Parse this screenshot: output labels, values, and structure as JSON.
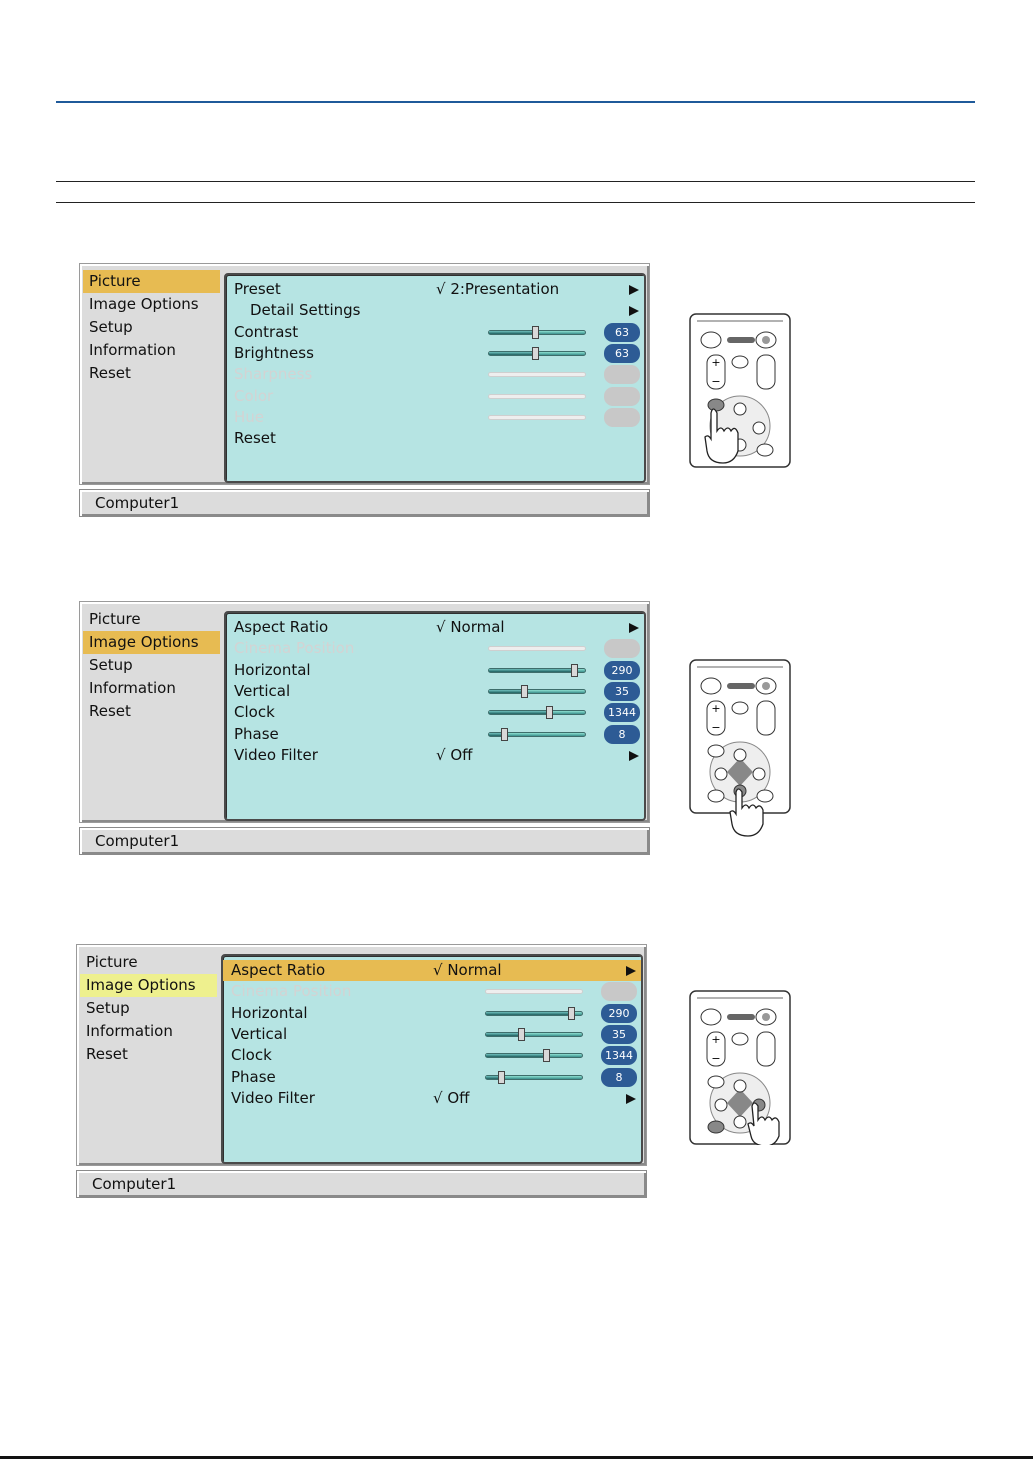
{
  "osd_screens": [
    {
      "menu": [
        {
          "label": "Picture",
          "state": "selected"
        },
        {
          "label": "Image Options",
          "state": ""
        },
        {
          "label": "Setup",
          "state": ""
        },
        {
          "label": "Information",
          "state": ""
        },
        {
          "label": "Reset",
          "state": ""
        }
      ],
      "rows": [
        {
          "label": "Preset",
          "value": "√ 2:Presentation",
          "arrow": true
        },
        {
          "label": "Detail Settings",
          "sub": true,
          "arrow": true
        },
        {
          "label": "Contrast",
          "slider": 0.49,
          "badge": "63"
        },
        {
          "label": "Brightness",
          "slider": 0.49,
          "badge": "63"
        },
        {
          "label": "Sharpness",
          "disabled": true,
          "slider": 0,
          "badge": ""
        },
        {
          "label": "Color",
          "disabled": true,
          "slider": 0,
          "badge": ""
        },
        {
          "label": "Hue",
          "disabled": true,
          "slider": 0,
          "badge": ""
        },
        {
          "label": "Reset"
        }
      ],
      "status": "Computer1"
    },
    {
      "menu": [
        {
          "label": "Picture",
          "state": ""
        },
        {
          "label": "Image Options",
          "state": "selected"
        },
        {
          "label": "Setup",
          "state": ""
        },
        {
          "label": "Information",
          "state": ""
        },
        {
          "label": "Reset",
          "state": ""
        }
      ],
      "rows": [
        {
          "label": "Aspect Ratio",
          "value": "√ Normal",
          "arrow": true
        },
        {
          "label": "Cinema Position",
          "disabled": true,
          "slider": 0,
          "badge": ""
        },
        {
          "label": "Horizontal",
          "slider": 0.9,
          "badge": "290"
        },
        {
          "label": "Vertical",
          "slider": 0.37,
          "badge": "35"
        },
        {
          "label": "Clock",
          "slider": 0.64,
          "badge": "1344"
        },
        {
          "label": "Phase",
          "slider": 0.17,
          "badge": "8"
        },
        {
          "label": "Video Filter",
          "value": "√ Off",
          "arrow": true
        }
      ],
      "status": "Computer1"
    },
    {
      "menu": [
        {
          "label": "Picture",
          "state": ""
        },
        {
          "label": "Image Options",
          "state": "selected-light"
        },
        {
          "label": "Setup",
          "state": ""
        },
        {
          "label": "Information",
          "state": ""
        },
        {
          "label": "Reset",
          "state": ""
        }
      ],
      "rows": [
        {
          "label": "Aspect Ratio",
          "value": "√ Normal",
          "arrow": true,
          "highlight": true
        },
        {
          "label": "Cinema Position",
          "disabled": true,
          "slider": 0,
          "badge": ""
        },
        {
          "label": "Horizontal",
          "slider": 0.9,
          "badge": "290"
        },
        {
          "label": "Vertical",
          "slider": 0.37,
          "badge": "35"
        },
        {
          "label": "Clock",
          "slider": 0.64,
          "badge": "1344"
        },
        {
          "label": "Phase",
          "slider": 0.17,
          "badge": "8"
        },
        {
          "label": "Video Filter",
          "value": "√ Off",
          "arrow": true
        }
      ],
      "status": "Computer1"
    }
  ],
  "remote_illustrations": [
    {
      "pressed_button": "menu-button"
    },
    {
      "pressed_button": "down-arrow-button"
    },
    {
      "pressed_button": "right-arrow-button"
    }
  ],
  "colors": {
    "rule_blue": "#1f5a9a",
    "menu_highlight": "#e7bb52",
    "menu_highlight_light": "#eef08e",
    "panel_background": "#b6e4e3",
    "badge": "#2d5b95"
  }
}
